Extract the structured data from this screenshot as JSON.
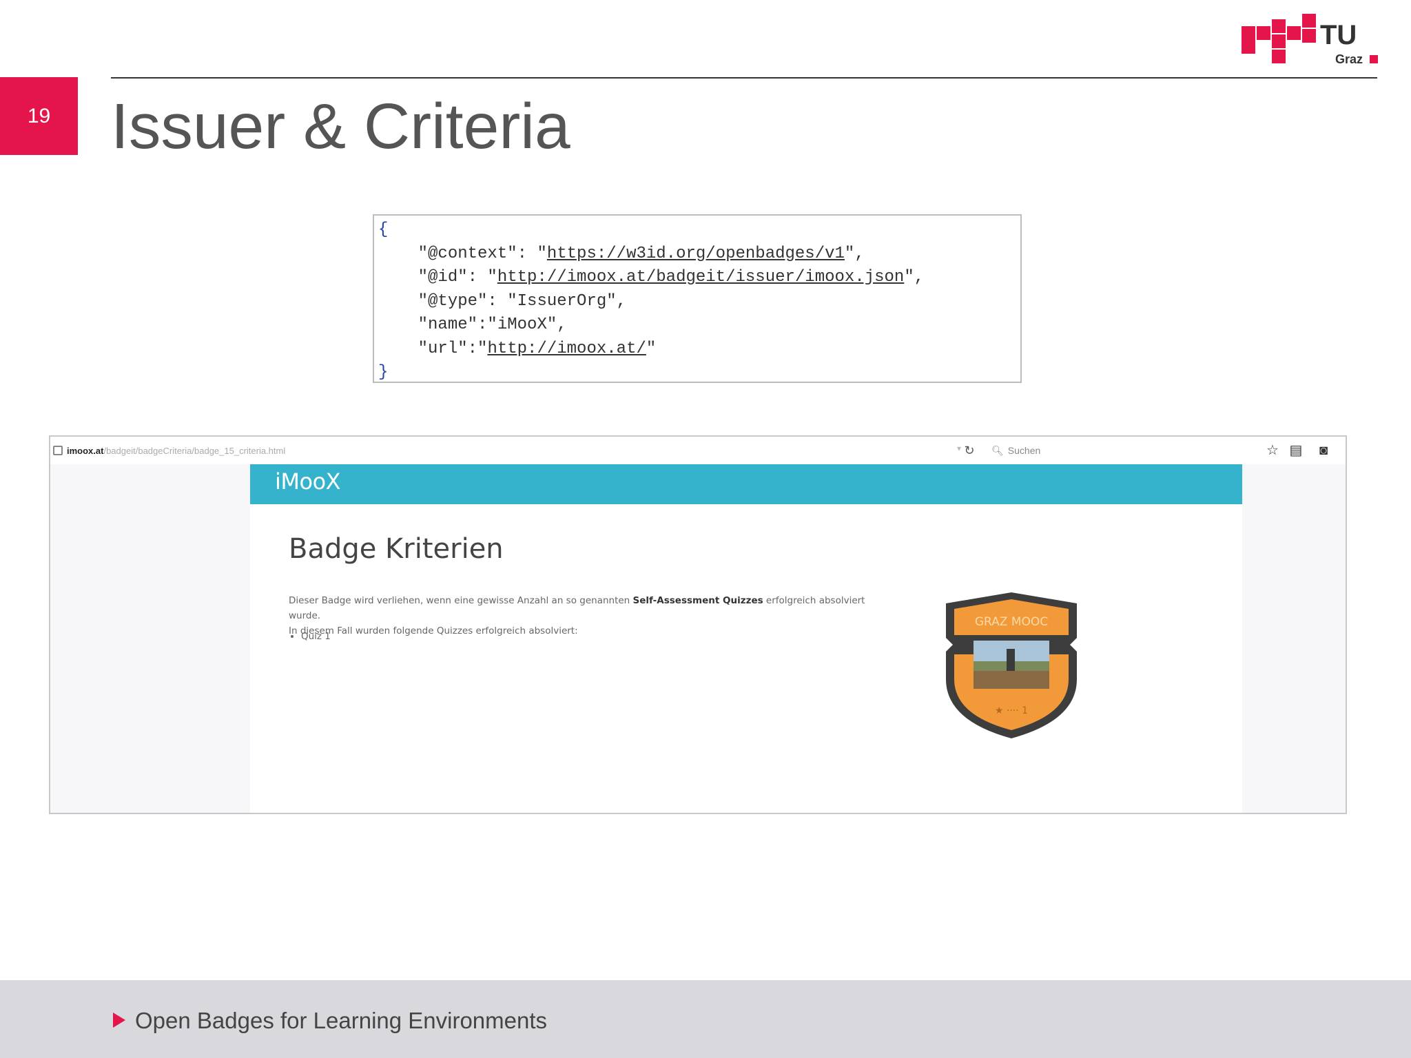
{
  "slide": {
    "number": "19",
    "title": "Issuer & Criteria",
    "footer": "Open Badges for Learning Environments"
  },
  "logo": {
    "text_main": "TU",
    "text_sub": "Graz"
  },
  "code": {
    "open": "{",
    "lines": [
      {
        "pre": "    \"@context\": \"",
        "link": "https://w3id.org/openbadges/v1",
        "post": "\","
      },
      {
        "pre": "    \"@id\": \"",
        "link": "http://imoox.at/badgeit/issuer/imoox.json",
        "post": "\","
      },
      {
        "pre": "    \"@type\": \"IssuerOrg\",",
        "link": "",
        "post": ""
      },
      {
        "pre": "    \"name\":\"iMooX\",",
        "link": "",
        "post": ""
      },
      {
        "pre": "    \"url\":\"",
        "link": "http://imoox.at/",
        "post": "\""
      }
    ],
    "close": "}"
  },
  "browser": {
    "url_domain": "imoox.at",
    "url_path": "/badgeit/badgeCriteria/badge_15_criteria.html",
    "search_placeholder": "Suchen",
    "site_logo": "iMooX",
    "heading": "Badge Kriterien",
    "text_part1": "Dieser Badge wird verliehen, wenn eine gewisse Anzahl an so genannten ",
    "text_bold": "Self-Assessment Quizzes",
    "text_part2": " erfolgreich absolviert wurde.",
    "text_line2": "In diesem Fall wurden folgende Quizzes erfolgreich absolviert:",
    "quiz_items": [
      "Quiz 1"
    ],
    "badge_label": "GRAZ MOOC"
  },
  "colors": {
    "accent": "#e4154b",
    "imoox_bar": "#35b3cc",
    "badge_orange": "#f29a3a",
    "badge_dark": "#3d3d3d",
    "footer_bg": "#d9d9dd"
  },
  "icons": [
    "lock-icon",
    "reload-icon",
    "search-icon",
    "star-icon",
    "clipboard-icon",
    "pocket-icon",
    "play-arrow-icon"
  ]
}
